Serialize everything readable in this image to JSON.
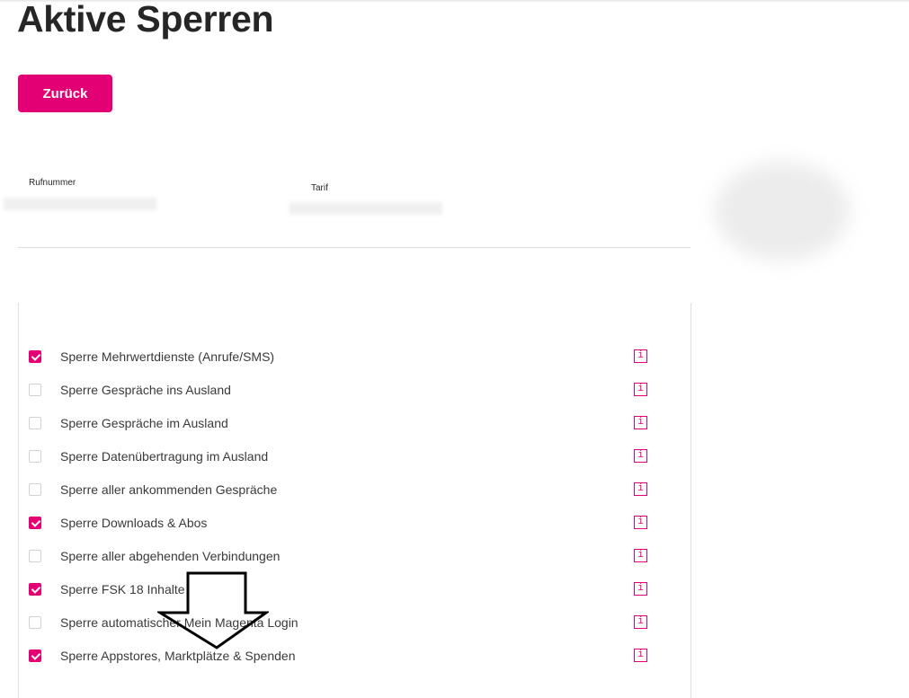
{
  "page": {
    "title": "Aktive Sperren"
  },
  "back_button": {
    "label": "Zurück"
  },
  "contract": {
    "phone_label": "Rufnummer",
    "tariff_label": "Tarif"
  },
  "info_button_glyph": "i",
  "locks": [
    {
      "label": "Sperre Mehrwertdienste (Anrufe/SMS)",
      "checked": true
    },
    {
      "label": "Sperre Gespräche ins Ausland",
      "checked": false
    },
    {
      "label": "Sperre Gespräche im Ausland",
      "checked": false
    },
    {
      "label": "Sperre Datenübertragung im Ausland",
      "checked": false
    },
    {
      "label": "Sperre aller ankommenden Gespräche",
      "checked": false
    },
    {
      "label": "Sperre Downloads & Abos",
      "checked": true
    },
    {
      "label": "Sperre aller abgehenden Verbindungen",
      "checked": false
    },
    {
      "label": "Sperre FSK 18 Inhalte",
      "checked": true
    },
    {
      "label": "Sperre automatischer Mein Magenta Login",
      "checked": false
    },
    {
      "label": "Sperre Appstores, Marktplätze & Spenden",
      "checked": true
    }
  ],
  "colors": {
    "accent": "#e20074",
    "text": "#262626",
    "border": "#d2d2d2"
  }
}
